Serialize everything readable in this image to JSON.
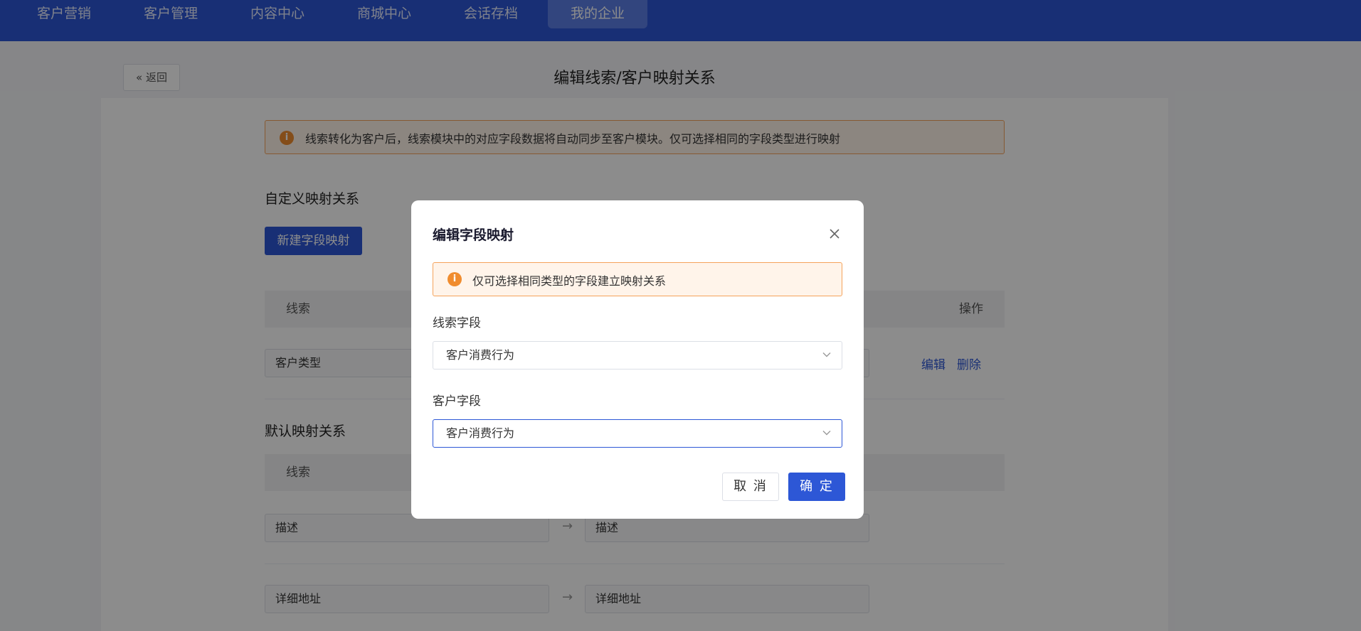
{
  "nav": {
    "items": [
      {
        "label": "客户营销"
      },
      {
        "label": "客户管理"
      },
      {
        "label": "内容中心"
      },
      {
        "label": "商城中心"
      },
      {
        "label": "会话存档"
      },
      {
        "label": "我的企业"
      }
    ],
    "active_index": 5
  },
  "page": {
    "back_label": "返回",
    "title": "编辑线索/客户映射关系",
    "notice": "线索转化为客户后，线索模块中的对应字段数据将自动同步至客户模块。仅可选择相同的字段类型进行映射",
    "custom_section": {
      "title": "自定义映射关系",
      "new_button": "新建字段映射",
      "col_lead": "线索",
      "col_action": "操作",
      "rows": [
        {
          "lead": "客户类型",
          "edit": "编辑",
          "delete": "删除"
        }
      ]
    },
    "default_section": {
      "title": "默认映射关系",
      "col_lead": "线索",
      "rows": [
        {
          "lead": "描述",
          "customer": "描述"
        },
        {
          "lead": "详细地址",
          "customer": "详细地址"
        }
      ]
    }
  },
  "modal": {
    "title": "编辑字段映射",
    "notice": "仅可选择相同类型的字段建立映射关系",
    "lead_field_label": "线索字段",
    "lead_field_value": "客户消费行为",
    "customer_field_label": "客户字段",
    "customer_field_value": "客户消费行为",
    "cancel_label": "取 消",
    "ok_label": "确 定"
  },
  "colors": {
    "primary": "#2d57d6",
    "warning": "#f08c2e"
  }
}
